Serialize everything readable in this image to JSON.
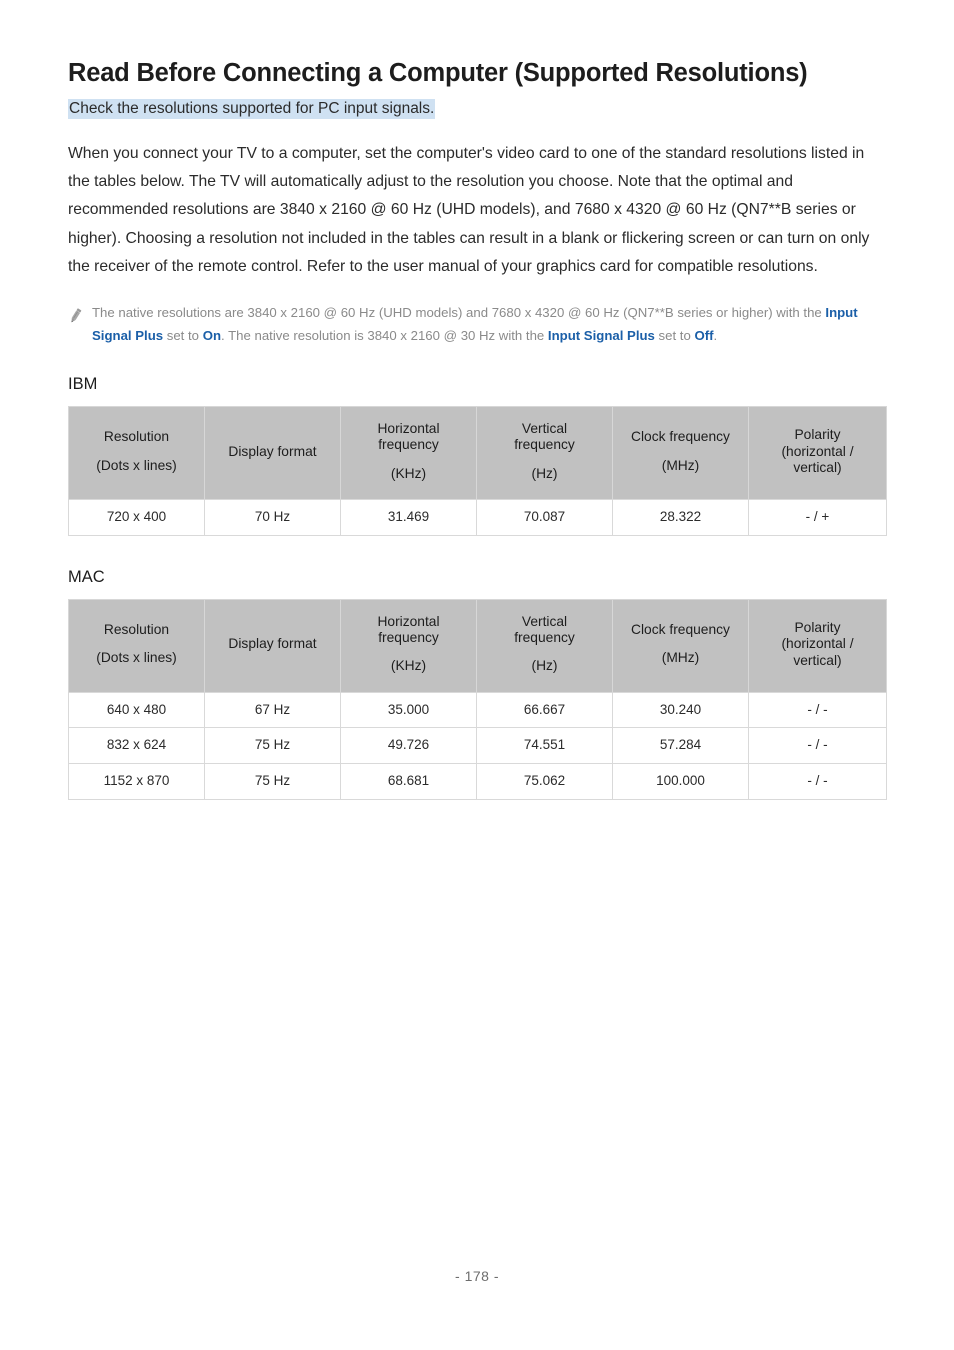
{
  "document": {
    "title": "Read Before Connecting a Computer (Supported Resolutions)",
    "subtitle": "Check the resolutions supported for PC input signals.",
    "body_paragraph": "When you connect your TV to a computer, set the computer's video card to one of the standard resolutions listed in the tables below. The TV will automatically adjust to the resolution you choose. Note that the optimal and recommended resolutions are 3840 x 2160 @ 60 Hz (UHD models), and 7680 x 4320 @ 60 Hz (QN7**B series or higher). Choosing a resolution not included in the tables can result in a blank or flickering screen or can turn on only the receiver of the remote control. Refer to the user manual of your graphics card for compatible resolutions.",
    "page_number": "- 178 -"
  },
  "note": {
    "icon": "pencil-icon",
    "segment_1": "The native resolutions are 3840 x 2160 @ 60 Hz (UHD models) and 7680 x 4320 @ 60 Hz (QN7**B series or higher) with the ",
    "link_1": "Input Signal Plus",
    "segment_2": " set to ",
    "link_2": "On",
    "segment_3": ". The native resolution is 3840 x 2160 @ 30 Hz with the ",
    "link_3": "Input Signal Plus",
    "segment_4": " set to ",
    "link_4": "Off",
    "segment_5": "."
  },
  "colors": {
    "highlight": "#cfe1f2",
    "link_blue": "#1b5fa8",
    "table_header_gray": "#c1c1c1",
    "table_border": "#d9d9d9",
    "note_text": "#8a8a8a"
  },
  "tables": [
    {
      "label": "IBM",
      "headers": [
        {
          "line1": "Resolution",
          "line2": "(Dots x lines)"
        },
        {
          "line1": "Display format",
          "line2": ""
        },
        {
          "line1": "Horizontal",
          "line1b": "frequency",
          "line2": "(KHz)"
        },
        {
          "line1": "Vertical",
          "line1b": "frequency",
          "line2": "(Hz)"
        },
        {
          "line1": "Clock frequency",
          "line2": "(MHz)"
        },
        {
          "line1": "Polarity",
          "line1b": "(horizontal /",
          "line1c": "vertical)"
        }
      ],
      "rows": [
        [
          "720 x 400",
          "70 Hz",
          "31.469",
          "70.087",
          "28.322",
          "- / +"
        ]
      ]
    },
    {
      "label": "MAC",
      "headers": [
        {
          "line1": "Resolution",
          "line2": "(Dots x lines)"
        },
        {
          "line1": "Display format",
          "line2": ""
        },
        {
          "line1": "Horizontal",
          "line1b": "frequency",
          "line2": "(KHz)"
        },
        {
          "line1": "Vertical",
          "line1b": "frequency",
          "line2": "(Hz)"
        },
        {
          "line1": "Clock frequency",
          "line2": "(MHz)"
        },
        {
          "line1": "Polarity",
          "line1b": "(horizontal /",
          "line1c": "vertical)"
        }
      ],
      "rows": [
        [
          "640 x 480",
          "67 Hz",
          "35.000",
          "66.667",
          "30.240",
          "- / -"
        ],
        [
          "832 x 624",
          "75 Hz",
          "49.726",
          "74.551",
          "57.284",
          "- / -"
        ],
        [
          "1152 x 870",
          "75 Hz",
          "68.681",
          "75.062",
          "100.000",
          "- / -"
        ]
      ]
    }
  ]
}
